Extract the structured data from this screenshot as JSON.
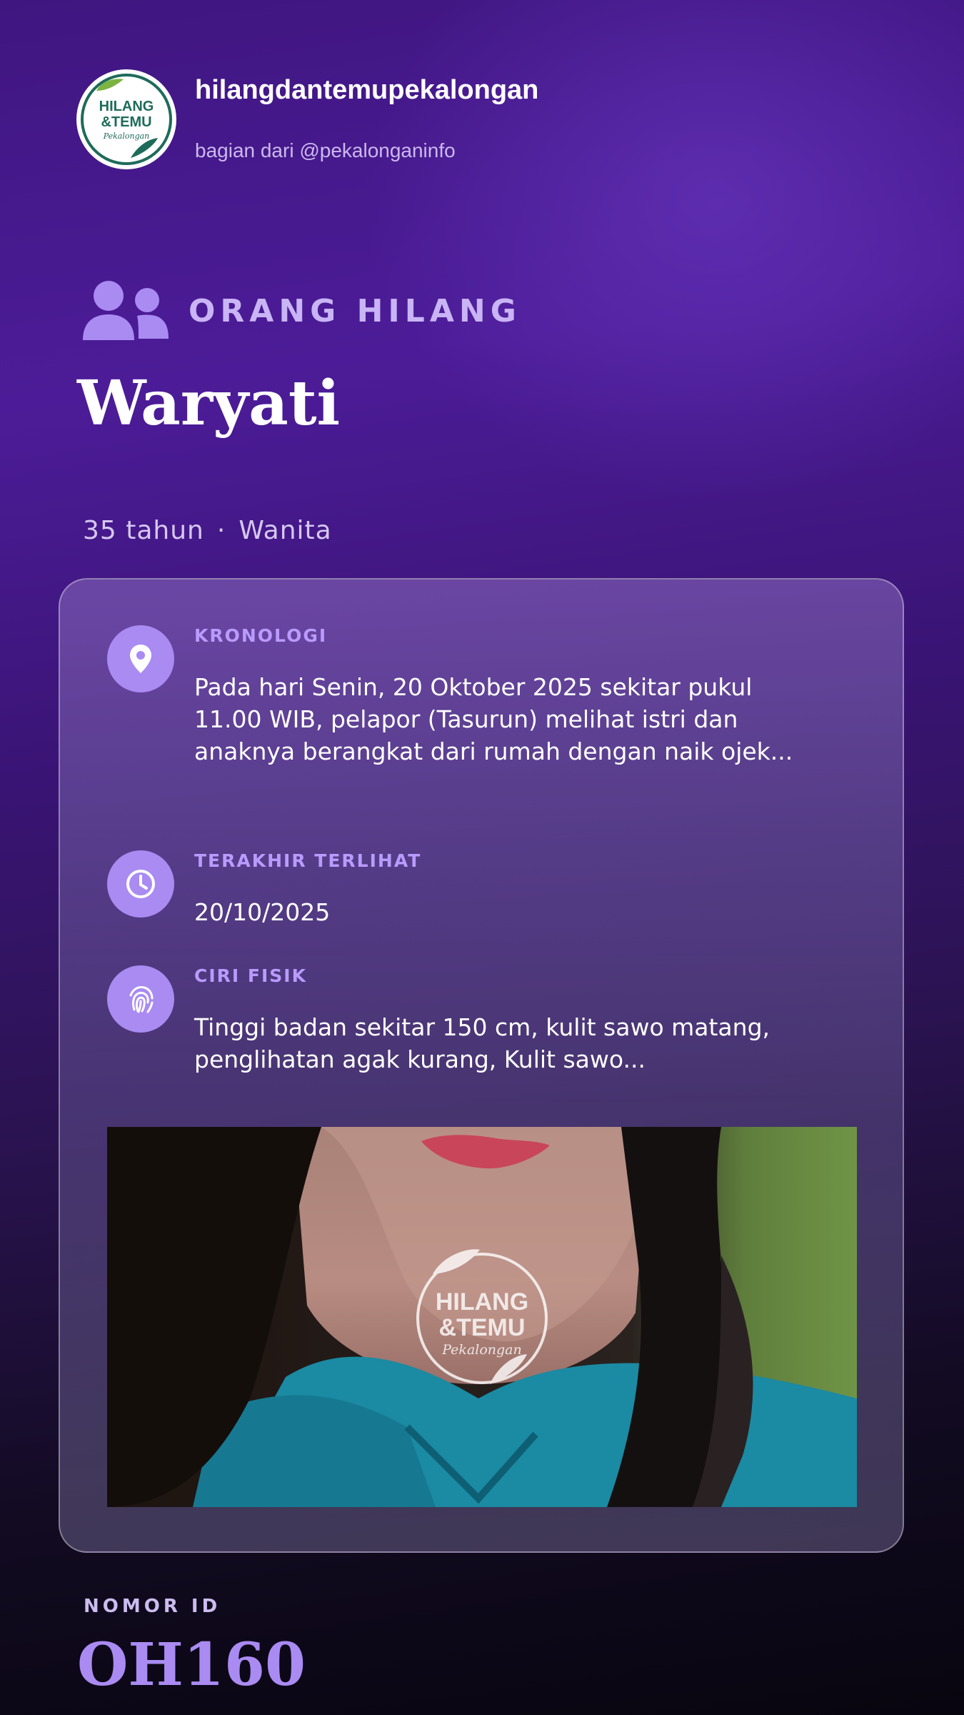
{
  "header": {
    "account_name": "hilangdantemupekalongan",
    "account_sub": "bagian dari @pekalonganinfo",
    "logo": {
      "line1": "HILANG",
      "line2": "&TEMU",
      "line3": "Pekalongan"
    }
  },
  "category": {
    "icon": "users-icon",
    "label": "ORANG HILANG"
  },
  "person": {
    "name": "Waryati",
    "age": "35 tahun",
    "separator": "·",
    "gender": "Wanita"
  },
  "details": [
    {
      "icon": "map-pin-icon",
      "label": "KRONOLOGI",
      "value": "Pada hari Senin, 20 Oktober 2025 sekitar pukul 11.00 WIB, pelapor (Tasurun) melihat istri dan anaknya berangkat dari rumah dengan naik ojek..."
    },
    {
      "icon": "clock-icon",
      "label": "TERAKHIR TERLIHAT",
      "value": "20/10/2025"
    },
    {
      "icon": "fingerprint-icon",
      "label": "CIRI FISIK",
      "value": "Tinggi badan sekitar 150 cm, kulit sawo matang, penglihatan agak kurang, Kulit sawo..."
    }
  ],
  "photo": {
    "watermark": {
      "line1": "HILANG",
      "line2": "&TEMU",
      "line3": "Pekalongan"
    }
  },
  "id": {
    "label": "NOMOR ID",
    "value": "OH160"
  },
  "colors": {
    "accent": "#a98bf2",
    "label_accent": "#b99bff",
    "logo_green": "#1f6b5a"
  }
}
